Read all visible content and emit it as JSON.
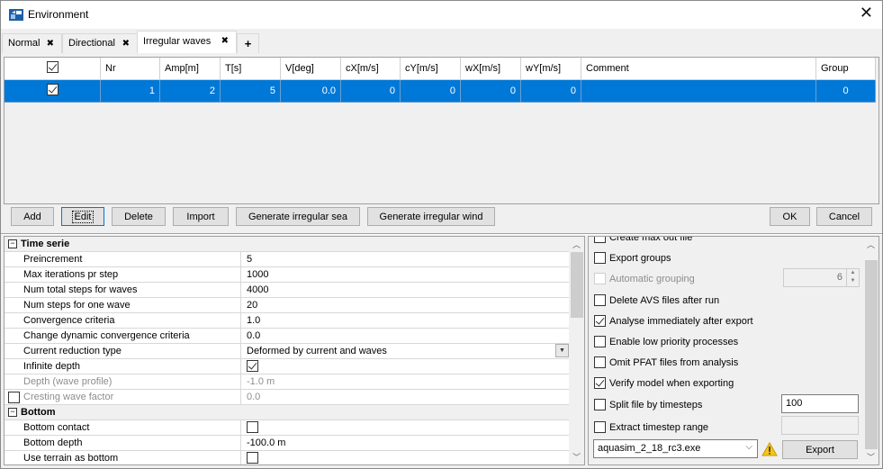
{
  "window": {
    "title": "Environment",
    "icon": "app-icon",
    "close_icon": "close-icon"
  },
  "tabs": [
    {
      "label": "Normal",
      "active": false,
      "closable": true
    },
    {
      "label": "Directional",
      "active": false,
      "closable": true
    },
    {
      "label": "Irregular waves",
      "active": true,
      "closable": true
    }
  ],
  "tab_add_label": "+",
  "tab_close_glyph": "✖",
  "grid": {
    "columns": [
      {
        "key": "enabled",
        "label": ""
      },
      {
        "key": "nr",
        "label": "Nr"
      },
      {
        "key": "amp",
        "label": "Amp[m]"
      },
      {
        "key": "t",
        "label": "T[s]"
      },
      {
        "key": "v",
        "label": "V[deg]"
      },
      {
        "key": "cx",
        "label": "cX[m/s]"
      },
      {
        "key": "cy",
        "label": "cY[m/s]"
      },
      {
        "key": "wx",
        "label": "wX[m/s]"
      },
      {
        "key": "wy",
        "label": "wY[m/s]"
      },
      {
        "key": "comment",
        "label": "Comment"
      },
      {
        "key": "group",
        "label": "Group"
      }
    ],
    "header_checked": true,
    "rows": [
      {
        "enabled": true,
        "nr": "1",
        "amp": "2",
        "t": "5",
        "v": "0.0",
        "cx": "0",
        "cy": "0",
        "wx": "0",
        "wy": "0",
        "comment": "",
        "group": "0",
        "selected": true
      }
    ]
  },
  "buttons": {
    "add": "Add",
    "edit": "Edit",
    "delete": "Delete",
    "import": "Import",
    "generate_sea": "Generate irregular sea",
    "generate_wind": "Generate irregular wind",
    "ok": "OK",
    "cancel": "Cancel",
    "export": "Export"
  },
  "properties": [
    {
      "type": "category",
      "name": "Time serie",
      "toggle": "⊟"
    },
    {
      "type": "text",
      "name": "Preincrement",
      "value": "5"
    },
    {
      "type": "text",
      "name": "Max iterations pr step",
      "value": "1000"
    },
    {
      "type": "text",
      "name": "Num total steps for waves",
      "value": "4000"
    },
    {
      "type": "text",
      "name": "Num steps for one wave",
      "value": "20"
    },
    {
      "type": "text",
      "name": "Convergence criteria",
      "value": "1.0"
    },
    {
      "type": "text",
      "name": "Change dynamic convergence criteria",
      "value": "0.0"
    },
    {
      "type": "combo",
      "name": "Current reduction type",
      "value": "Deformed by current and waves"
    },
    {
      "type": "check",
      "name": "Infinite depth",
      "checked": true
    },
    {
      "type": "text",
      "name": "Depth (wave profile)",
      "value": "-1.0 m",
      "disabled": true
    },
    {
      "type": "text",
      "name": "Cresting wave factor",
      "value": "0.0",
      "disabled": true,
      "row_checkbox": true,
      "row_checked": false
    },
    {
      "type": "category",
      "name": "Bottom",
      "toggle": "⊟"
    },
    {
      "type": "check",
      "name": "Bottom contact",
      "checked": false
    },
    {
      "type": "text",
      "name": "Bottom depth",
      "value": "-100.0 m"
    },
    {
      "type": "check",
      "name": "Use terrain as bottom",
      "checked": false
    }
  ],
  "export_options": [
    {
      "label": "Create max out file",
      "checked": false
    },
    {
      "label": "Export groups",
      "checked": false
    },
    {
      "label": "Automatic grouping",
      "checked": false,
      "disabled": true
    },
    {
      "label": "Delete AVS files after run",
      "checked": false
    },
    {
      "label": "Analyse immediately after export",
      "checked": true
    },
    {
      "label": "Enable low priority processes",
      "checked": false
    },
    {
      "label": "Omit PFAT files from analysis",
      "checked": false
    },
    {
      "label": "Verify model when exporting",
      "checked": true
    },
    {
      "label": "Split file by timesteps",
      "checked": false
    },
    {
      "label": "Extract timestep range",
      "checked": false
    }
  ],
  "auto_grouping_value": "6",
  "split_timesteps_value": "100",
  "timestep_range_value": "",
  "executable": {
    "selected": "aquasim_2_18_rc3.exe",
    "warning_icon": "warning-icon"
  },
  "colors": {
    "selection": "#0078d7",
    "focus": "#0078d7",
    "warning": "#f5c518"
  }
}
